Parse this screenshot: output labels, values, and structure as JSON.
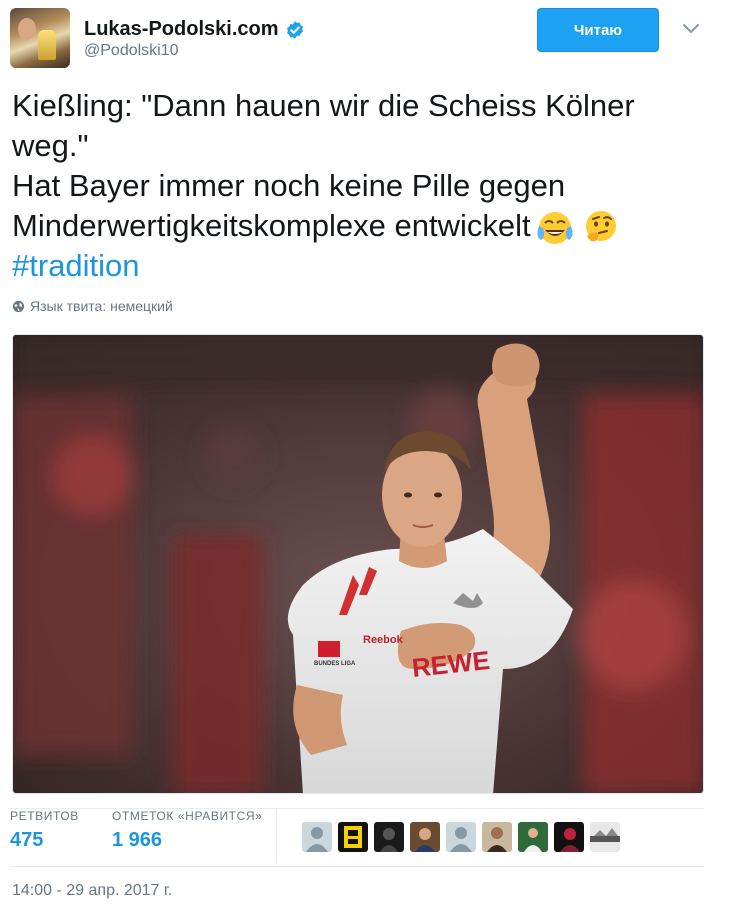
{
  "author": {
    "name": "Lukas-Podolski.com",
    "handle": "@Podolski10",
    "verified": true
  },
  "follow_button": {
    "label": "Читаю"
  },
  "tweet": {
    "lines": [
      "Kießling: \"Dann hauen wir die Scheiss Kölner",
      "weg.\"",
      "Hat Bayer immer noch keine Pille gegen",
      "Minderwertigkeitskomplexe entwickelt"
    ],
    "emojis": [
      "face-with-tears-of-joy",
      "thinking-face"
    ],
    "hashtag": "#tradition"
  },
  "language_note": "Язык твита: немецкий",
  "media": {
    "sponsor_text": "Reebok",
    "shirt_text": "REWE",
    "badge_text": "BUNDES LIGA"
  },
  "stats": {
    "retweets": {
      "label": "РЕТВИТОВ",
      "value": "475"
    },
    "likes": {
      "label": "ОТМЕТОК «НРАВИТСЯ»",
      "value": "1 966"
    }
  },
  "likers": [
    "default-avatar",
    "yellow-black-avatar",
    "dark-photo-avatar",
    "person-avatar",
    "default-avatar",
    "person-avatar",
    "green-sport-avatar",
    "red-dark-avatar",
    "landscape-avatar"
  ],
  "timestamp": "14:00 - 29 апр. 2017 г.",
  "colors": {
    "accent": "#1da1f2",
    "link": "#1b95e0",
    "muted": "#657786"
  }
}
